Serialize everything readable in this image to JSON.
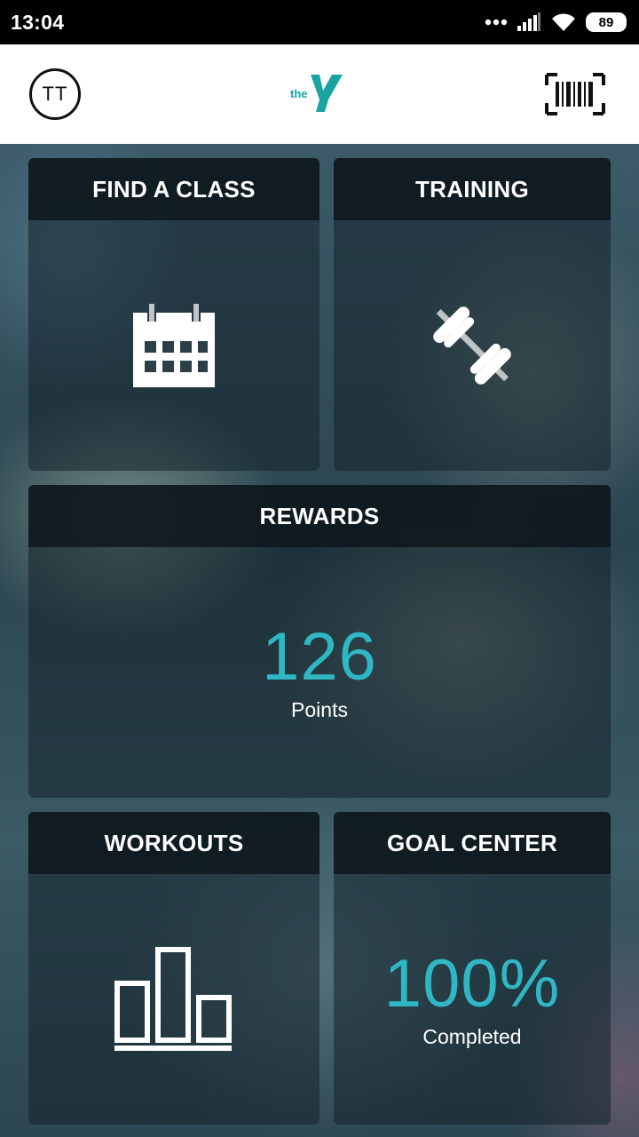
{
  "status_bar": {
    "time": "13:04",
    "battery": "89",
    "icons": [
      "dots-icon",
      "signal-icon",
      "wifi-icon",
      "battery-icon"
    ]
  },
  "header": {
    "avatar_initials": "TT",
    "logo_text": "the",
    "logo_name": "ymca-logo",
    "barcode_icon": "barcode-icon"
  },
  "tiles": {
    "find_class": {
      "title": "FIND A CLASS",
      "icon": "calendar-icon"
    },
    "training": {
      "title": "TRAINING",
      "icon": "dumbbell-icon"
    },
    "rewards": {
      "title": "REWARDS",
      "value": "126",
      "label": "Points"
    },
    "workouts": {
      "title": "WORKOUTS",
      "icon": "bar-chart-icon"
    },
    "goal_center": {
      "title": "GOAL CENTER",
      "value": "100%",
      "label": "Completed"
    }
  },
  "colors": {
    "accent": "#2fb7c3",
    "header_bg": "#ffffff",
    "status_bar_bg": "#000000"
  }
}
